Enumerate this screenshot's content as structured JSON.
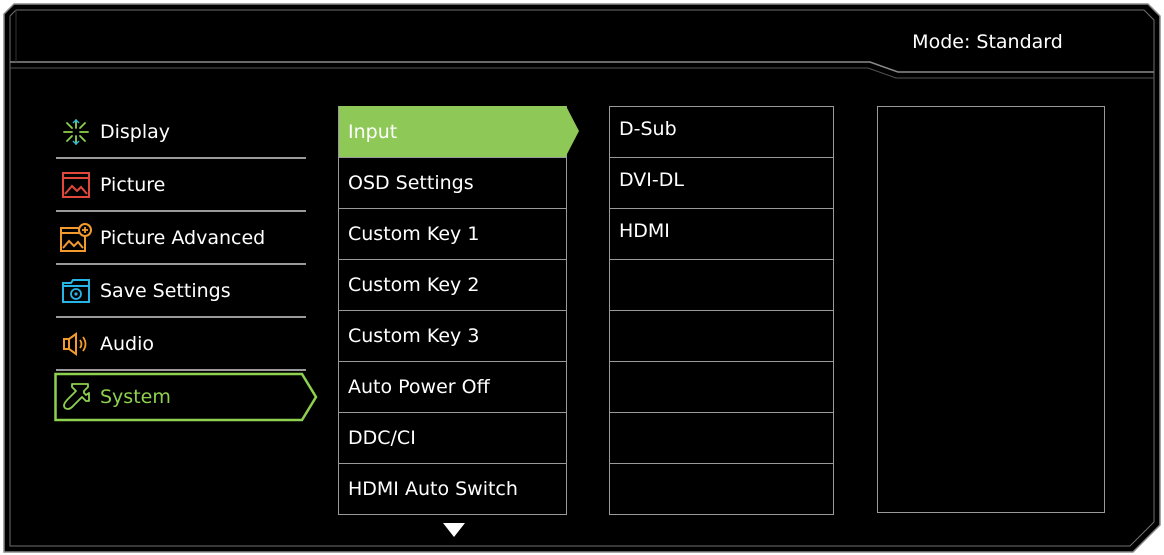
{
  "header": {
    "mode_label": "Mode: Standard"
  },
  "left_menu": {
    "items": [
      {
        "label": "Display",
        "icon": "display-icon",
        "selected": false
      },
      {
        "label": "Picture",
        "icon": "picture-icon",
        "selected": false
      },
      {
        "label": "Picture Advanced",
        "icon": "picture-advanced-icon",
        "selected": false
      },
      {
        "label": "Save Settings",
        "icon": "save-settings-icon",
        "selected": false
      },
      {
        "label": "Audio",
        "icon": "audio-icon",
        "selected": false
      },
      {
        "label": "System",
        "icon": "wrench-icon",
        "selected": true
      }
    ]
  },
  "system_menu": {
    "items": [
      {
        "label": "Input",
        "active": true
      },
      {
        "label": "OSD Settings",
        "active": false
      },
      {
        "label": "Custom Key 1",
        "active": false
      },
      {
        "label": "Custom Key 2",
        "active": false
      },
      {
        "label": "Custom Key 3",
        "active": false
      },
      {
        "label": "Auto Power Off",
        "active": false
      },
      {
        "label": "DDC/CI",
        "active": false
      },
      {
        "label": "HDMI Auto Switch",
        "active": false
      }
    ],
    "more_indicator": "scroll-down-arrow-icon"
  },
  "input_options": {
    "items": [
      "D-Sub",
      "DVI-DL",
      "HDMI",
      "",
      "",
      "",
      "",
      ""
    ]
  },
  "colors": {
    "background": "#000000",
    "accent_green": "#8ec856",
    "selected_text_green": "#8ed14f",
    "divider_gray": "#9a9a9a",
    "icon_red": "#e2473b",
    "icon_cyan": "#27b5e6",
    "icon_orange": "#f29a2e",
    "icon_green": "#8ed14f"
  }
}
